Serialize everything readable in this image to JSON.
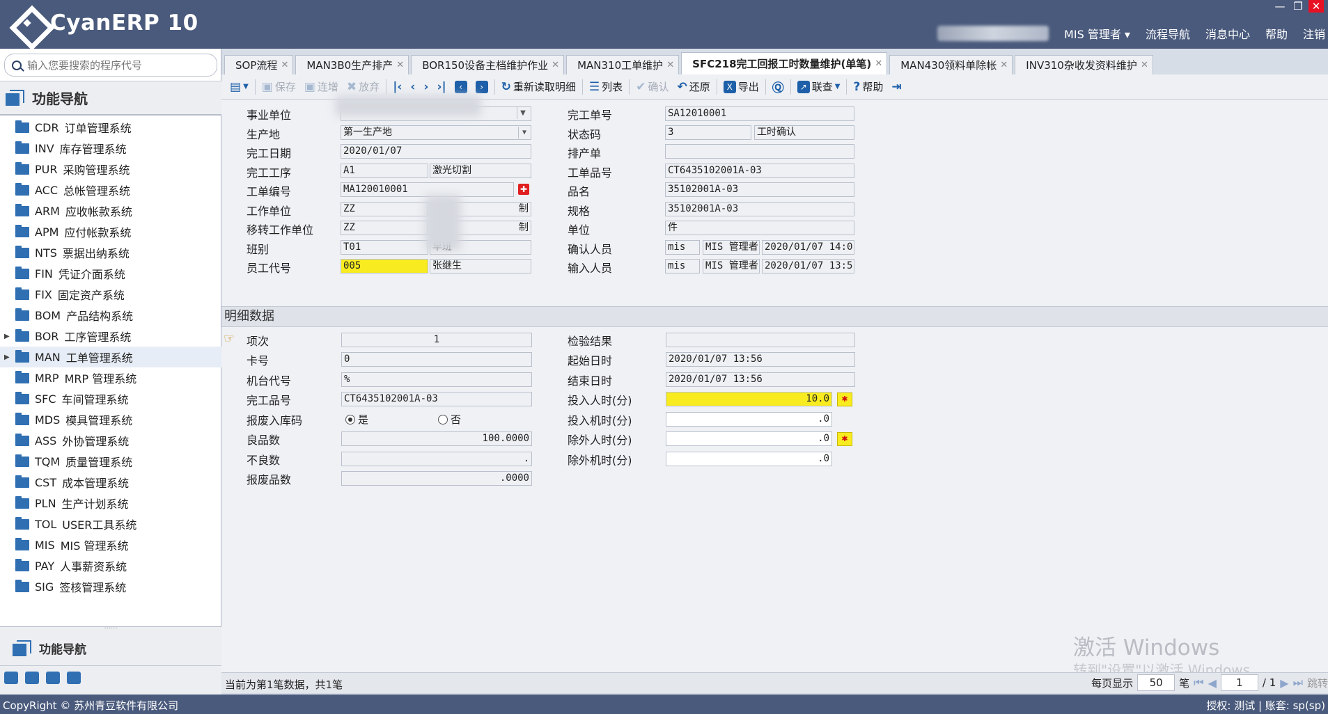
{
  "app": {
    "name": "CyanERP 10"
  },
  "topbar": {
    "window_controls": [
      "—",
      "❐",
      "✕"
    ],
    "menu": [
      "MIS 管理者 ▾",
      "流程导航",
      "消息中心",
      "帮助",
      "注销"
    ]
  },
  "sidebar": {
    "search_placeholder": "输入您要搜索的程序代号",
    "nav_title": "功能导航",
    "items": [
      {
        "code": "CDR",
        "label": "订单管理系统"
      },
      {
        "code": "INV",
        "label": "库存管理系统"
      },
      {
        "code": "PUR",
        "label": "采购管理系统"
      },
      {
        "code": "ACC",
        "label": "总帐管理系统"
      },
      {
        "code": "ARM",
        "label": "应收帐款系统"
      },
      {
        "code": "APM",
        "label": "应付帐款系统"
      },
      {
        "code": "NTS",
        "label": "票据出纳系统"
      },
      {
        "code": "FIN",
        "label": "凭证介面系统"
      },
      {
        "code": "FIX",
        "label": "固定资产系统"
      },
      {
        "code": "BOM",
        "label": "产品结构系统"
      },
      {
        "code": "BOR",
        "label": "工序管理系统"
      },
      {
        "code": "MAN",
        "label": "工单管理系统"
      },
      {
        "code": "MRP",
        "label": "MRP 管理系统"
      },
      {
        "code": "SFC",
        "label": "车间管理系统"
      },
      {
        "code": "MDS",
        "label": "模具管理系统"
      },
      {
        "code": "ASS",
        "label": "外协管理系统"
      },
      {
        "code": "TQM",
        "label": "质量管理系统"
      },
      {
        "code": "CST",
        "label": "成本管理系统"
      },
      {
        "code": "PLN",
        "label": "生产计划系统"
      },
      {
        "code": "TOL",
        "label": "USER工具系统"
      },
      {
        "code": "MIS",
        "label": "MIS 管理系统"
      },
      {
        "code": "PAY",
        "label": "人事薪资系统"
      },
      {
        "code": "SIG",
        "label": "签核管理系统"
      }
    ],
    "bottom_title": "功能导航"
  },
  "tabs": [
    {
      "label": "SOP流程",
      "active": false
    },
    {
      "label": "MAN3B0生产排产",
      "active": false
    },
    {
      "label": "BOR150设备主档维护作业",
      "active": false
    },
    {
      "label": "MAN310工单维护",
      "active": false
    },
    {
      "label": "SFC218完工回报工时数量维护(单笔)",
      "active": true
    },
    {
      "label": "MAN430领料单除帐",
      "active": false
    },
    {
      "label": "INV310杂收发资料维护",
      "active": false
    }
  ],
  "toolbar": {
    "save": "保存",
    "continue_add": "连增",
    "discard": "放弃",
    "reload_detail": "重新读取明细",
    "list": "列表",
    "confirm": "确认",
    "restore": "还原",
    "export": "导出",
    "query_link": "联查",
    "help": "帮助"
  },
  "header": {
    "labels": {
      "business_unit": "事业单位",
      "production_site": "生产地",
      "finish_date": "完工日期",
      "finish_process": "完工工序",
      "work_order_no": "工单编号",
      "work_unit": "工作单位",
      "transfer_unit": "移转工作单位",
      "shift": "班别",
      "employee_code": "员工代号",
      "finish_no": "完工单号",
      "status_code": "状态码",
      "schedule": "排产单",
      "wo_item_no": "工单品号",
      "item_name": "品名",
      "spec": "规格",
      "unit": "单位",
      "confirmer": "确认人员",
      "inputter": "输入人员"
    },
    "values": {
      "business_unit": "",
      "production_site": "第一生产地",
      "finish_date": "2020/01/07",
      "finish_process_code": "A1",
      "finish_process_name": "激光切割",
      "work_order_no": "MA120010001",
      "work_unit_code": "ZZ",
      "work_unit_name": "制",
      "transfer_unit_code": "ZZ",
      "transfer_unit_name": "制",
      "shift_code": "T01",
      "shift_name": "早班",
      "employee_code": "005",
      "employee_name": "张继生",
      "finish_no": "SA12010001",
      "status_code": "3",
      "status_name": "工时确认",
      "schedule": "",
      "wo_item_no": "CT6435102001A-03",
      "item_name": "35102001A-03",
      "spec": "35102001A-03",
      "unit": "件",
      "confirmer_id": "mis",
      "confirmer_name": "MIS 管理者",
      "confirm_time": "2020/01/07 14:0",
      "inputter_id": "mis",
      "inputter_name": "MIS 管理者",
      "input_time": "2020/01/07 13:5"
    }
  },
  "detail": {
    "title": "明细数据",
    "labels": {
      "seq": "项次",
      "card_no": "卡号",
      "machine_code": "机台代号",
      "finish_item_no": "完工品号",
      "scrap_in_stock": "报废入库码",
      "good_qty": "良品数",
      "bad_qty": "不良数",
      "scrap_qty": "报废品数",
      "inspection": "检验结果",
      "start_time": "起始日时",
      "end_time": "结束日时",
      "input_man_hours": "投入人时(分)",
      "input_machine_hours": "投入机时(分)",
      "excl_man_hours": "除外人时(分)",
      "excl_machine_hours": "除外机时(分)"
    },
    "values": {
      "seq": "1",
      "card_no": "0",
      "machine_code": "%",
      "finish_item_no": "CT6435102001A-03",
      "scrap_yes": "是",
      "scrap_no": "否",
      "scrap_selected": "是",
      "good_qty": "100.0000",
      "bad_qty": ".",
      "scrap_qty": ".0000",
      "inspection": "",
      "start_time": "2020/01/07 13:56",
      "end_time": "2020/01/07 13:56",
      "input_man_hours": "10.0",
      "input_machine_hours": ".0",
      "excl_man_hours": ".0",
      "excl_machine_hours": ".0"
    }
  },
  "watermark": {
    "line1": "激活 Windows",
    "line2": "转到\"设置\"以激活 Windows"
  },
  "status": {
    "message": "当前为第1笔数据，共1笔",
    "per_page_label": "每页显示",
    "per_page": "50",
    "unit": "笔",
    "page": "1",
    "total_pages": "/ 1",
    "jump": "跳转"
  },
  "footer": {
    "copyright": "CopyRight © 苏州青豆软件有限公司",
    "auth": "授权: 测试 | 账套: sp(sp)"
  }
}
